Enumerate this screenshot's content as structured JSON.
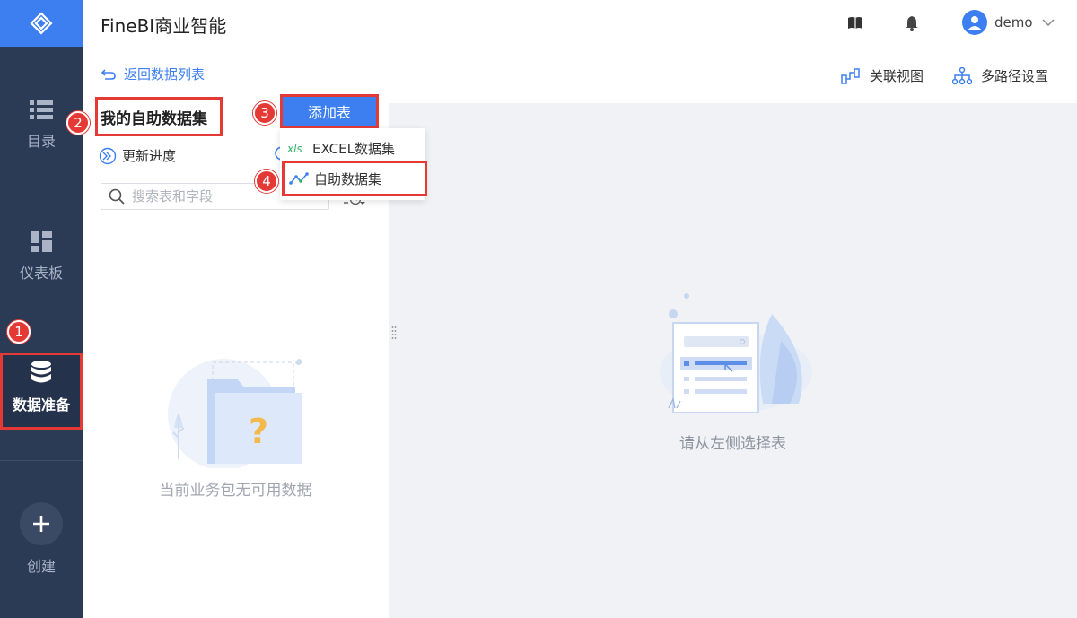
{
  "app": {
    "title": "FineBI商业智能"
  },
  "header": {
    "user_name": "demo"
  },
  "nav": {
    "items": [
      {
        "label": "目录",
        "icon": "list-icon"
      },
      {
        "label": "仪表板",
        "icon": "dashboard-icon"
      },
      {
        "label": "数据准备",
        "icon": "database-icon",
        "active": true
      },
      {
        "label": "创建",
        "icon": "plus-icon"
      }
    ]
  },
  "panel": {
    "back_label": "返回数据列表",
    "title": "我的自助数据集",
    "progress_label": "更新进度",
    "search_placeholder": "搜索表和字段",
    "empty_text": "当前业务包无可用数据"
  },
  "add_menu": {
    "button_label": "添加表",
    "items": [
      {
        "label": "EXCEL数据集",
        "icon": "xls-icon"
      },
      {
        "label": "自助数据集",
        "icon": "self-service-dataset-icon"
      }
    ]
  },
  "main": {
    "toolbar": [
      {
        "label": "关联视图",
        "icon": "relation-view-icon"
      },
      {
        "label": "多路径设置",
        "icon": "multipath-icon"
      }
    ],
    "empty_text": "请从左侧选择表"
  },
  "badges": [
    "1",
    "2",
    "3",
    "4"
  ],
  "colors": {
    "nav_bg": "#2b3a55",
    "accent": "#3d7ff0",
    "annotation": "#e53935"
  }
}
